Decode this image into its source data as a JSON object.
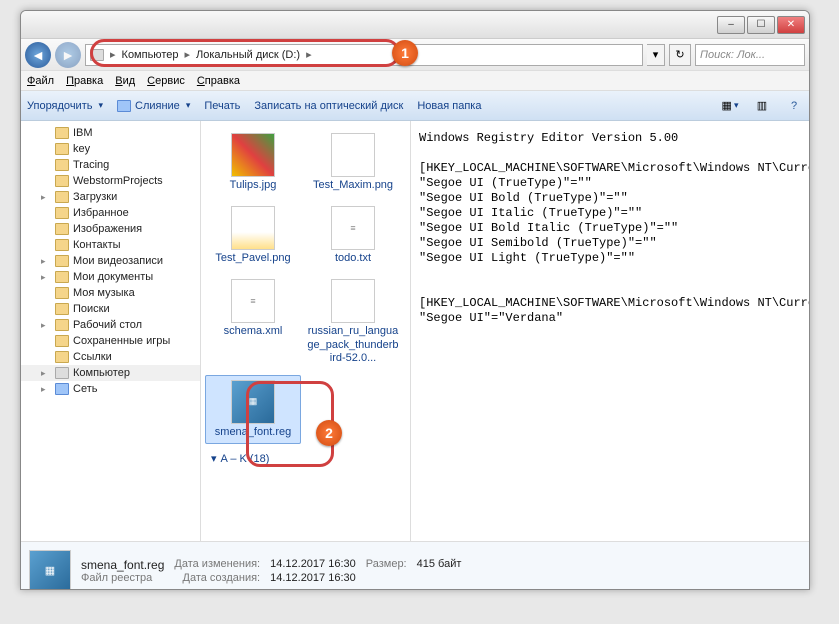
{
  "titlebar": {
    "min": "–",
    "max": "☐",
    "close": "✕"
  },
  "nav": {
    "crumb1": "Компьютер",
    "crumb2": "Локальный диск (D:)",
    "sep": "▸",
    "searchPlaceholder": "Поиск: Лок..."
  },
  "menu": {
    "file": "Файл",
    "edit": "Правка",
    "view": "Вид",
    "tools": "Сервис",
    "help": "Справка"
  },
  "toolbar": {
    "organize": "Упорядочить",
    "merge": "Слияние",
    "print": "Печать",
    "burn": "Записать на оптический диск",
    "newfolder": "Новая папка"
  },
  "tree": [
    {
      "arw": "",
      "label": "IBM",
      "icon": "fi"
    },
    {
      "arw": "",
      "label": "key",
      "icon": "fi"
    },
    {
      "arw": "",
      "label": "Tracing",
      "icon": "fi"
    },
    {
      "arw": "",
      "label": "WebstormProjects",
      "icon": "fi"
    },
    {
      "arw": "▸",
      "label": "Загрузки",
      "icon": "fi"
    },
    {
      "arw": "",
      "label": "Избранное",
      "icon": "fi"
    },
    {
      "arw": "",
      "label": "Изображения",
      "icon": "fi"
    },
    {
      "arw": "",
      "label": "Контакты",
      "icon": "fi"
    },
    {
      "arw": "▸",
      "label": "Мои видеозаписи",
      "icon": "fi"
    },
    {
      "arw": "▸",
      "label": "Мои документы",
      "icon": "fi"
    },
    {
      "arw": "",
      "label": "Моя музыка",
      "icon": "fi"
    },
    {
      "arw": "",
      "label": "Поиски",
      "icon": "fi"
    },
    {
      "arw": "▸",
      "label": "Рабочий стол",
      "icon": "fi"
    },
    {
      "arw": "",
      "label": "Сохраненные игры",
      "icon": "fi"
    },
    {
      "arw": "",
      "label": "Ссылки",
      "icon": "fi"
    },
    {
      "arw": "▸",
      "label": "Компьютер",
      "icon": "fi grey",
      "sel": true
    },
    {
      "arw": "▸",
      "label": "Сеть",
      "icon": "fi blue"
    }
  ],
  "files": {
    "f1": "Tulips.jpg",
    "f2": "Test_Maxim.png",
    "f3": "Test_Pavel.png",
    "f4": "todo.txt",
    "f5": "schema.xml",
    "f6": "russian_ru_language_pack_thunderbird-52.0...",
    "f7": "smena_font.reg",
    "group": "A – K (18)",
    "groupArrow": "▾"
  },
  "preview_text": "Windows Registry Editor Version 5.00\n\n[HKEY_LOCAL_MACHINE\\SOFTWARE\\Microsoft\\Windows NT\\CurrentVersion\\Fonts]\n\"Segoe UI (TrueType)\"=\"\"\n\"Segoe UI Bold (TrueType)\"=\"\"\n\"Segoe UI Italic (TrueType)\"=\"\"\n\"Segoe UI Bold Italic (TrueType)\"=\"\"\n\"Segoe UI Semibold (TrueType)\"=\"\"\n\"Segoe UI Light (TrueType)\"=\"\"\n\n\n[HKEY_LOCAL_MACHINE\\SOFTWARE\\Microsoft\\Windows NT\\CurrentVersion\\FontSubstitutes]\n\"Segoe UI\"=\"Verdana\"",
  "details": {
    "name": "smena_font.reg",
    "type": "Файл реестра",
    "k1": "Дата изменения:",
    "v1": "14.12.2017 16:30",
    "k2": "Размер:",
    "v2": "415 байт",
    "k3": "Дата создания:",
    "v3": "14.12.2017 16:30"
  },
  "markers": {
    "one": "1",
    "two": "2"
  }
}
